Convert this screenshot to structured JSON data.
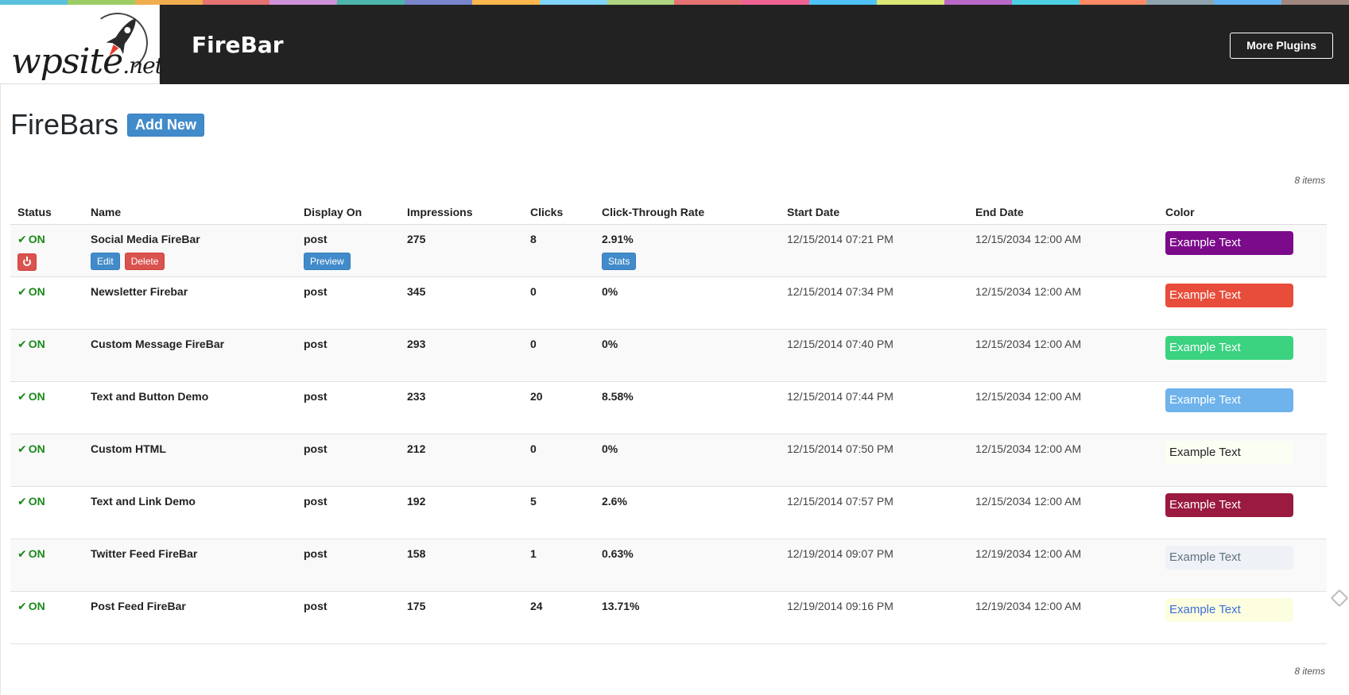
{
  "strip_colors": [
    "#5bc0de",
    "#9ccc65",
    "#f0ad4e",
    "#e57373",
    "#ce93d8",
    "#4db6ac",
    "#7986cb",
    "#ffb74d",
    "#81d4fa",
    "#aed581",
    "#e57373",
    "#f06292",
    "#4fc3f7",
    "#dce775",
    "#ba68c8",
    "#4dd0e1",
    "#ff8a65",
    "#90a4ae",
    "#64b5f6",
    "#a1887f"
  ],
  "logo": {
    "text_main": "wpsite",
    "text_suffix": ".net"
  },
  "header": {
    "app_title": "FireBar",
    "more_plugins_label": "More Plugins"
  },
  "page": {
    "title": "FireBars",
    "add_new_label": "Add New",
    "items_count_top": "8 items",
    "items_count_bottom": "8 items"
  },
  "table": {
    "columns": [
      "Status",
      "Name",
      "Display On",
      "Impressions",
      "Clicks",
      "Click-Through Rate",
      "Start Date",
      "End Date",
      "Color"
    ],
    "actions": {
      "edit": "Edit",
      "delete": "Delete",
      "preview": "Preview",
      "stats": "Stats"
    },
    "rows": [
      {
        "status": "ON",
        "name": "Social Media FireBar",
        "display_on": "post",
        "impressions": "275",
        "clicks": "8",
        "ctr": "2.91%",
        "start": "12/15/2014 07:21 PM",
        "end": "12/15/2034 12:00 AM",
        "color_label": "Example Text",
        "bg": "#7b0b8b",
        "fg": "#ffffff"
      },
      {
        "status": "ON",
        "name": "Newsletter Firebar",
        "display_on": "post",
        "impressions": "345",
        "clicks": "0",
        "ctr": "0%",
        "start": "12/15/2014 07:34 PM",
        "end": "12/15/2034 12:00 AM",
        "color_label": "Example Text",
        "bg": "#e84d3b",
        "fg": "#ffffff"
      },
      {
        "status": "ON",
        "name": "Custom Message FireBar",
        "display_on": "post",
        "impressions": "293",
        "clicks": "0",
        "ctr": "0%",
        "start": "12/15/2014 07:40 PM",
        "end": "12/15/2034 12:00 AM",
        "color_label": "Example Text",
        "bg": "#3bd280",
        "fg": "#ffffff"
      },
      {
        "status": "ON",
        "name": "Text and Button Demo",
        "display_on": "post",
        "impressions": "233",
        "clicks": "20",
        "ctr": "8.58%",
        "start": "12/15/2014 07:44 PM",
        "end": "12/15/2034 12:00 AM",
        "color_label": "Example Text",
        "bg": "#6eb3ec",
        "fg": "#ffffff"
      },
      {
        "status": "ON",
        "name": "Custom HTML",
        "display_on": "post",
        "impressions": "212",
        "clicks": "0",
        "ctr": "0%",
        "start": "12/15/2014 07:50 PM",
        "end": "12/15/2034 12:00 AM",
        "color_label": "Example Text",
        "bg": "#fbfff3",
        "fg": "#222222"
      },
      {
        "status": "ON",
        "name": "Text and Link Demo",
        "display_on": "post",
        "impressions": "192",
        "clicks": "5",
        "ctr": "2.6%",
        "start": "12/15/2014 07:57 PM",
        "end": "12/15/2034 12:00 AM",
        "color_label": "Example Text",
        "bg": "#9b1a3f",
        "fg": "#ffffff"
      },
      {
        "status": "ON",
        "name": "Twitter Feed FireBar",
        "display_on": "post",
        "impressions": "158",
        "clicks": "1",
        "ctr": "0.63%",
        "start": "12/19/2014 09:07 PM",
        "end": "12/19/2034 12:00 AM",
        "color_label": "Example Text",
        "bg": "#eef2f6",
        "fg": "#607080"
      },
      {
        "status": "ON",
        "name": "Post Feed FireBar",
        "display_on": "post",
        "impressions": "175",
        "clicks": "24",
        "ctr": "13.71%",
        "start": "12/19/2014 09:16 PM",
        "end": "12/19/2034 12:00 AM",
        "color_label": "Example Text",
        "bg": "#fdfde0",
        "fg": "#3b6fd8"
      }
    ]
  }
}
